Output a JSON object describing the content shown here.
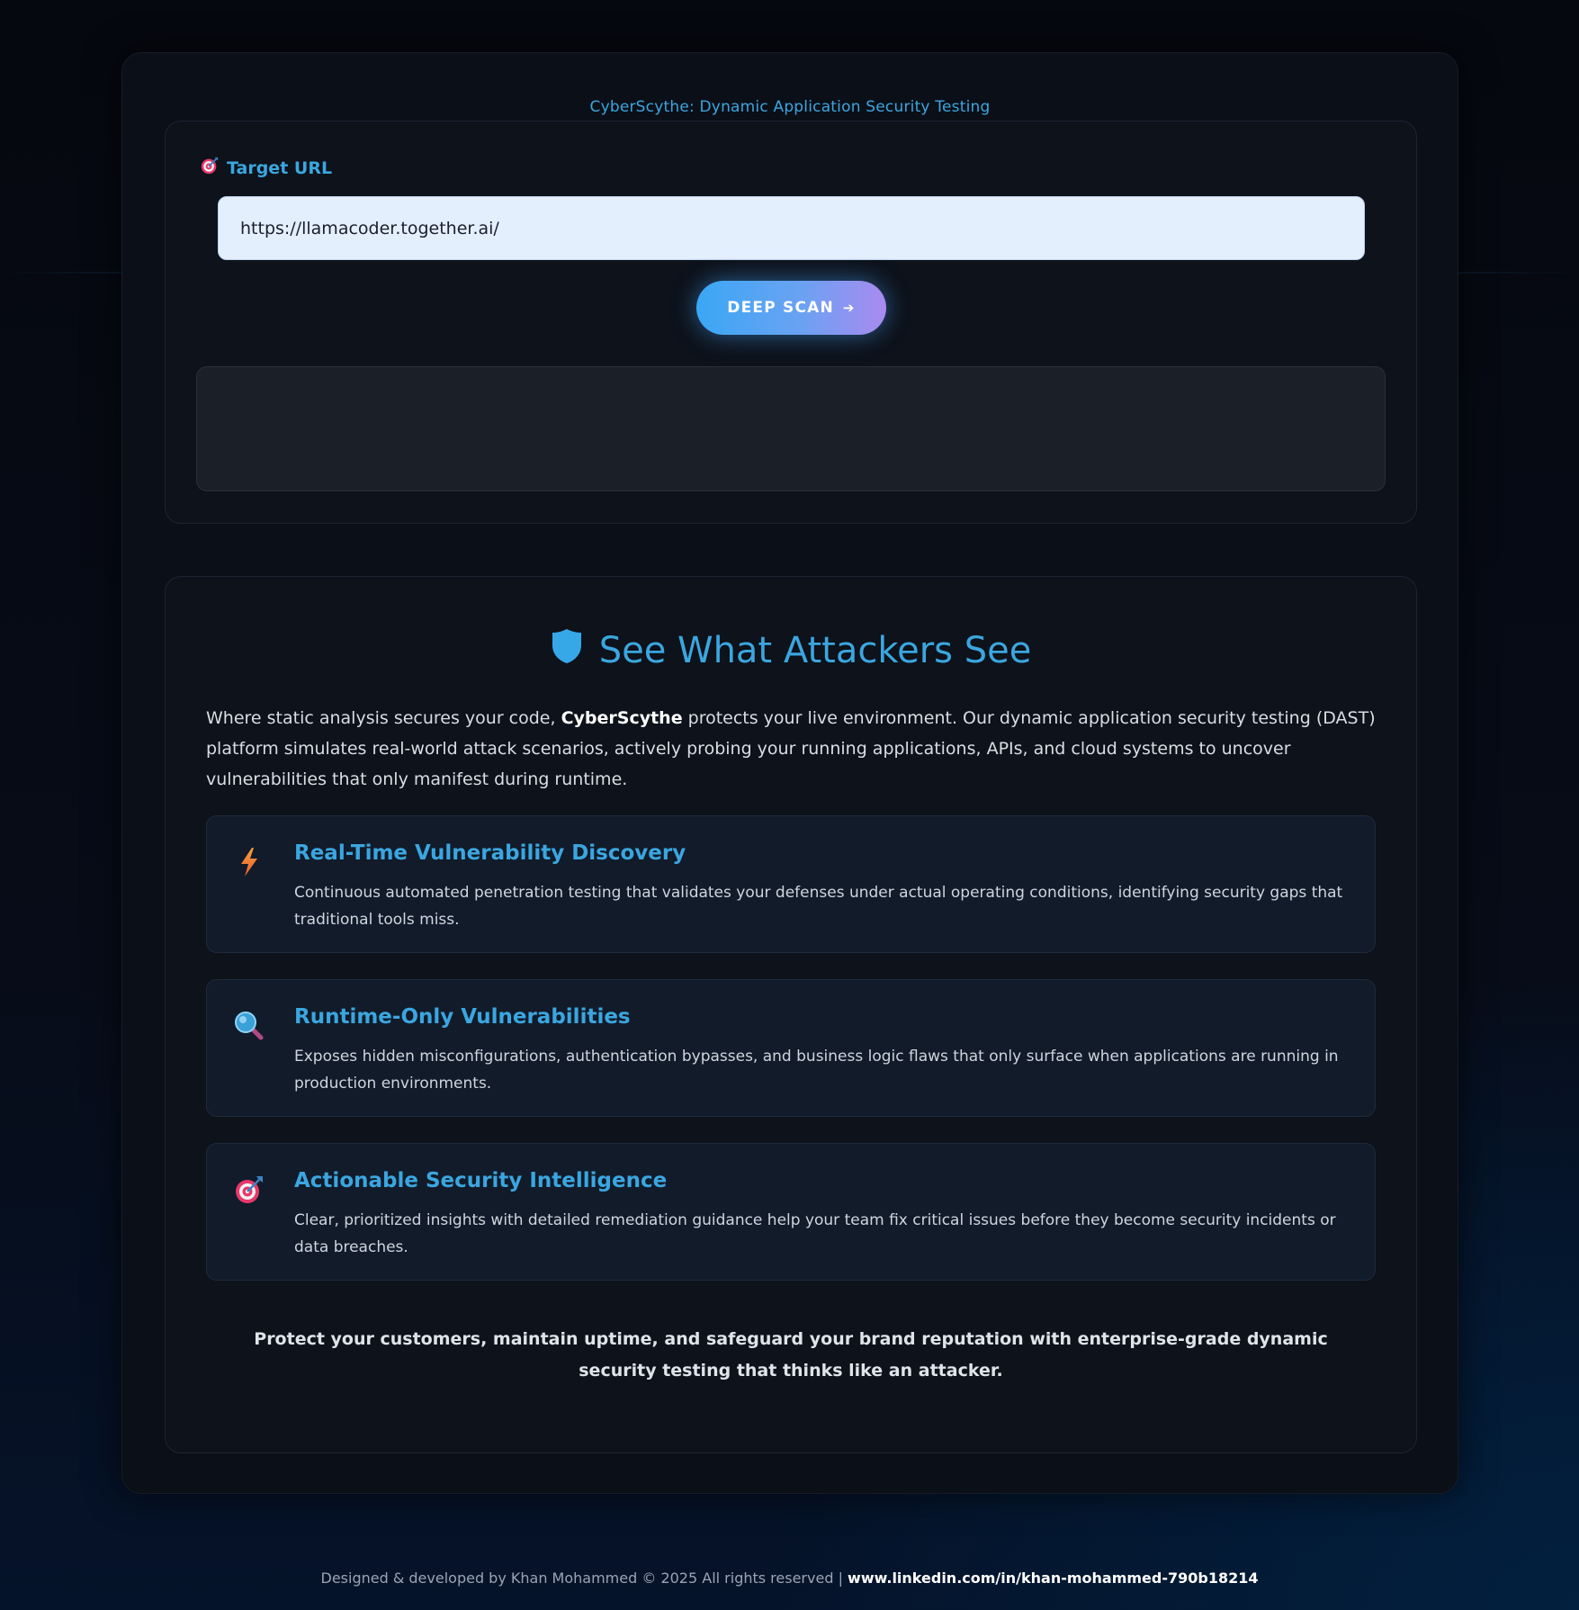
{
  "app": {
    "title": "CyberScythe: Dynamic Application Security Testing"
  },
  "scan": {
    "label": "Target URL",
    "label_icon": "target-icon",
    "url_value": "https://llamacoder.together.ai/",
    "button_label": "DEEP SCAN",
    "button_icon": "arrow-right-icon",
    "result_text": ""
  },
  "info": {
    "heading": "See What Attackers See",
    "heading_icon": "shield-icon",
    "intro_before": "Where static analysis secures your code, ",
    "intro_brand": "CyberScythe",
    "intro_after": " protects your live environment. Our dynamic application security testing (DAST) platform simulates real-world attack scenarios, actively probing your running applications, APIs, and cloud systems to uncover vulnerabilities that only manifest during runtime.",
    "features": [
      {
        "icon": "lightning-icon",
        "title": "Real-Time Vulnerability Discovery",
        "description": "Continuous automated penetration testing that validates your defenses under actual operating conditions, identifying security gaps that traditional tools miss."
      },
      {
        "icon": "magnifier-icon",
        "title": "Runtime-Only Vulnerabilities",
        "description": "Exposes hidden misconfigurations, authentication bypasses, and business logic flaws that only surface when applications are running in production environments."
      },
      {
        "icon": "target-icon",
        "title": "Actionable Security Intelligence",
        "description": "Clear, prioritized insights with detailed remediation guidance help your team fix critical issues before they become security incidents or data breaches."
      }
    ],
    "closing": "Protect your customers, maintain uptime, and safeguard your brand reputation with enterprise-grade dynamic security testing that thinks like an attacker."
  },
  "footer": {
    "text": "Designed & developed by Khan Mohammed © 2025 All rights reserved | ",
    "link_text": "www.linkedin.com/in/khan-mohammed-790b18214"
  },
  "colors": {
    "accent": "#3ba6df",
    "button_gradient_start": "#3aa7f5",
    "button_gradient_end": "#a98af0",
    "input_bg": "#e4effe"
  }
}
